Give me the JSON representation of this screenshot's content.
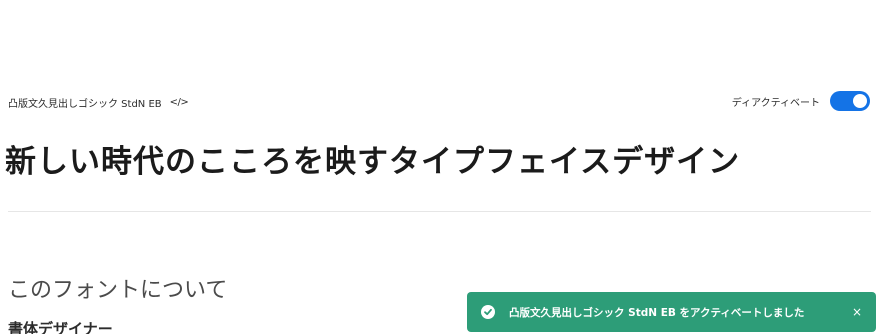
{
  "font": {
    "name": "凸版文久見出しゴシック StdN EB",
    "embed_icon": "</>"
  },
  "activation": {
    "label": "ディアクティベート",
    "state": "on",
    "accent_color": "#1473e6"
  },
  "sample": {
    "text": "新しい時代のこころを映すタイプフェイスデザイン"
  },
  "about": {
    "heading": "このフォントについて",
    "designer_heading": "書体デザイナー"
  },
  "toast": {
    "message": "凸版文久見出しゴシック StdN EB をアクティベートしました",
    "close": "×",
    "icon": "check-circle-icon",
    "color": "#2d9d78"
  }
}
